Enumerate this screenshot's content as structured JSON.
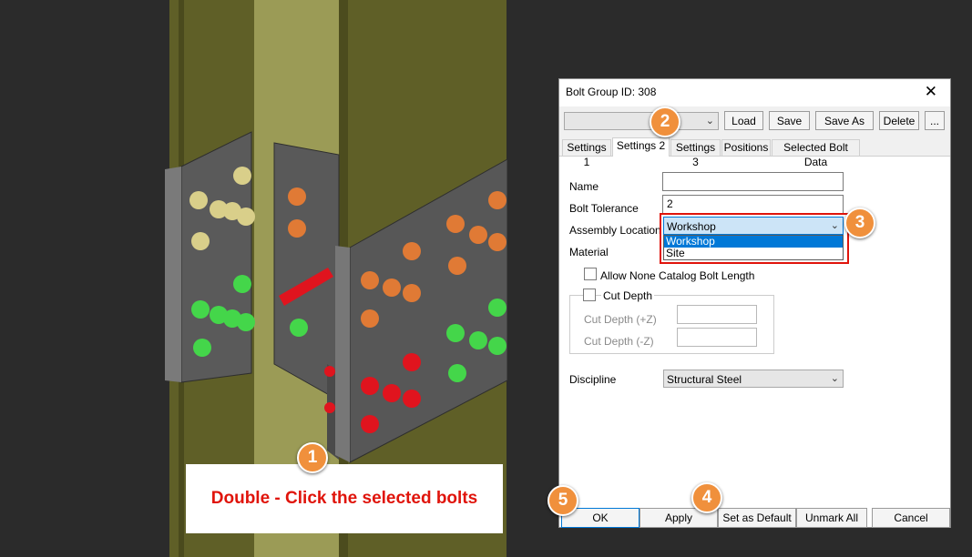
{
  "dialog": {
    "title": "Bolt Group ID: 308",
    "close_glyph": "✕",
    "toolbar": {
      "preset_value": "",
      "buttons": [
        "Load",
        "Save",
        "Save As",
        "Delete",
        "..."
      ]
    },
    "tabs": [
      "Settings 1",
      "Settings 2",
      "Settings 3",
      "Positions",
      "Selected Bolt Data"
    ],
    "active_tab": "Settings 2",
    "fields": {
      "name_label": "Name",
      "name_value": "",
      "tolerance_label": "Bolt Tolerance",
      "tolerance_value": "2",
      "assembly_label": "Assembly Location",
      "assembly_value": "Workshop",
      "assembly_options": [
        "Workshop",
        "Site"
      ],
      "material_label": "Material",
      "allow_none_catalog_label": "Allow None Catalog Bolt Length",
      "cut_depth_label": "Cut Depth",
      "cut_depth_plus_label": "Cut Depth (+Z)",
      "cut_depth_minus_label": "Cut Depth (-Z)",
      "discipline_label": "Discipline",
      "discipline_value": "Structural Steel"
    },
    "footer_buttons": [
      "OK",
      "Apply",
      "Set as Default",
      "Unmark All",
      "Cancel"
    ]
  },
  "callouts": [
    "1",
    "2",
    "3",
    "4",
    "5"
  ],
  "instruction": "Double - Click the selected bolts",
  "colors": {
    "callout": "#f0903c",
    "highlight": "#e0140b",
    "column": "#6b6b2c",
    "column_face": "#9c9c54",
    "bolt_orange": "#e07a35",
    "bolt_green": "#44d64a",
    "bolt_red": "#e0141e",
    "bolt_yellow": "#d9cf8a"
  },
  "icons": {
    "close": "close-icon",
    "dropdown": "chevron-down-icon"
  }
}
